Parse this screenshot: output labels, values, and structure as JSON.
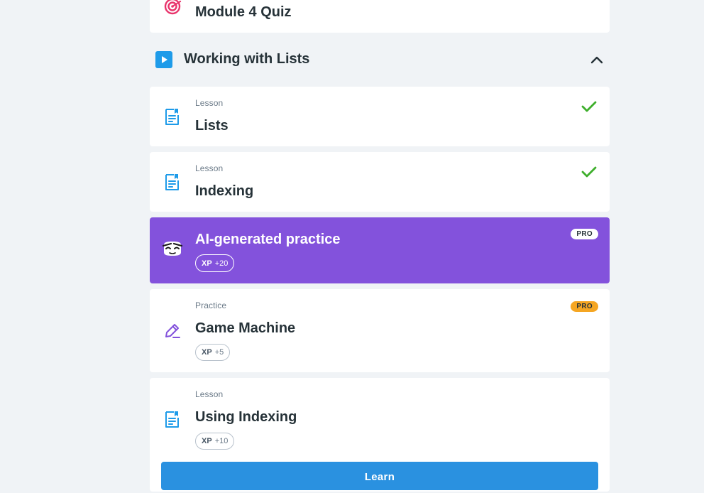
{
  "prev_module": {
    "title": "Module 4 Quiz"
  },
  "section": {
    "title": "Working with Lists"
  },
  "items": [
    {
      "type": "Lesson",
      "title": "Lists",
      "completed": true
    },
    {
      "type": "Lesson",
      "title": "Indexing",
      "completed": true
    },
    {
      "title": "AI-generated practice",
      "badge": "PRO",
      "xp_label": "XP",
      "xp_value": "+20"
    },
    {
      "type": "Practice",
      "title": "Game Machine",
      "badge": "PRO",
      "xp_label": "XP",
      "xp_value": "+5"
    },
    {
      "type": "Lesson",
      "title": "Using Indexing",
      "xp_label": "XP",
      "xp_value": "+10"
    }
  ],
  "learn_button": {
    "label": "Learn"
  },
  "colors": {
    "background": "#f0f3f6",
    "accent_blue": "#1e9be9",
    "ai_purple": "#8352dc",
    "check_green": "#3dae2b",
    "quiz_pink": "#e8336b",
    "pro_orange": "#f5a623"
  }
}
